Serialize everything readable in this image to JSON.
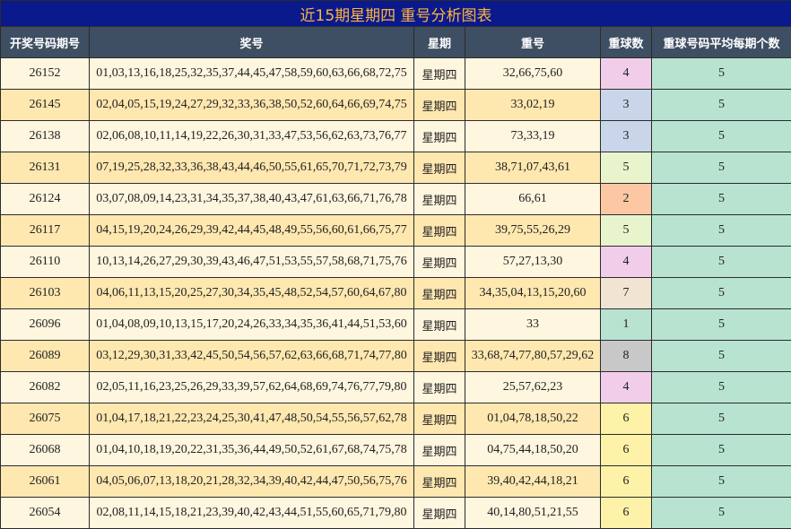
{
  "title": "近15期星期四 重号分析图表",
  "headers": [
    "开奖号码期号",
    "奖号",
    "星期",
    "重号",
    "重球数",
    "重球号码平均每期个数"
  ],
  "colors": {
    "title_bg": "#0a1a8c",
    "title_text": "#ffb43c",
    "header_bg": "#3e4e63",
    "row_light": "#fff6df",
    "row_dark": "#ffe8b0",
    "avg_bg": "#b8e3d1",
    "count_by_value": {
      "1": "#b8e3d1",
      "2": "#fcc8a4",
      "3": "#c9d6ea",
      "4": "#f2cde9",
      "5": "#e8f5cc",
      "6": "#fdf2a8",
      "7": "#f1e4d2",
      "8": "#c8c8c8"
    }
  },
  "rows": [
    {
      "period": "26152",
      "numbers": "01,03,13,16,18,25,32,35,37,44,45,47,58,59,60,63,66,68,72,75",
      "weekday": "星期四",
      "repeats": "32,66,75,60",
      "count": "4",
      "avg": "5"
    },
    {
      "period": "26145",
      "numbers": "02,04,05,15,19,24,27,29,32,33,36,38,50,52,60,64,66,69,74,75",
      "weekday": "星期四",
      "repeats": "33,02,19",
      "count": "3",
      "avg": "5"
    },
    {
      "period": "26138",
      "numbers": "02,06,08,10,11,14,19,22,26,30,31,33,47,53,56,62,63,73,76,77",
      "weekday": "星期四",
      "repeats": "73,33,19",
      "count": "3",
      "avg": "5"
    },
    {
      "period": "26131",
      "numbers": "07,19,25,28,32,33,36,38,43,44,46,50,55,61,65,70,71,72,73,79",
      "weekday": "星期四",
      "repeats": "38,71,07,43,61",
      "count": "5",
      "avg": "5"
    },
    {
      "period": "26124",
      "numbers": "03,07,08,09,14,23,31,34,35,37,38,40,43,47,61,63,66,71,76,78",
      "weekday": "星期四",
      "repeats": "66,61",
      "count": "2",
      "avg": "5"
    },
    {
      "period": "26117",
      "numbers": "04,15,19,20,24,26,29,39,42,44,45,48,49,55,56,60,61,66,75,77",
      "weekday": "星期四",
      "repeats": "39,75,55,26,29",
      "count": "5",
      "avg": "5"
    },
    {
      "period": "26110",
      "numbers": "10,13,14,26,27,29,30,39,43,46,47,51,53,55,57,58,68,71,75,76",
      "weekday": "星期四",
      "repeats": "57,27,13,30",
      "count": "4",
      "avg": "5"
    },
    {
      "period": "26103",
      "numbers": "04,06,11,13,15,20,25,27,30,34,35,45,48,52,54,57,60,64,67,80",
      "weekday": "星期四",
      "repeats": "34,35,04,13,15,20,60",
      "count": "7",
      "avg": "5"
    },
    {
      "period": "26096",
      "numbers": "01,04,08,09,10,13,15,17,20,24,26,33,34,35,36,41,44,51,53,60",
      "weekday": "星期四",
      "repeats": "33",
      "count": "1",
      "avg": "5"
    },
    {
      "period": "26089",
      "numbers": "03,12,29,30,31,33,42,45,50,54,56,57,62,63,66,68,71,74,77,80",
      "weekday": "星期四",
      "repeats": "33,68,74,77,80,57,29,62",
      "count": "8",
      "avg": "5"
    },
    {
      "period": "26082",
      "numbers": "02,05,11,16,23,25,26,29,33,39,57,62,64,68,69,74,76,77,79,80",
      "weekday": "星期四",
      "repeats": "25,57,62,23",
      "count": "4",
      "avg": "5"
    },
    {
      "period": "26075",
      "numbers": "01,04,17,18,21,22,23,24,25,30,41,47,48,50,54,55,56,57,62,78",
      "weekday": "星期四",
      "repeats": "01,04,78,18,50,22",
      "count": "6",
      "avg": "5"
    },
    {
      "period": "26068",
      "numbers": "01,04,10,18,19,20,22,31,35,36,44,49,50,52,61,67,68,74,75,78",
      "weekday": "星期四",
      "repeats": "04,75,44,18,50,20",
      "count": "6",
      "avg": "5"
    },
    {
      "period": "26061",
      "numbers": "04,05,06,07,13,18,20,21,28,32,34,39,40,42,44,47,50,56,75,76",
      "weekday": "星期四",
      "repeats": "39,40,42,44,18,21",
      "count": "6",
      "avg": "5"
    },
    {
      "period": "26054",
      "numbers": "02,08,11,14,15,18,21,23,39,40,42,43,44,51,55,60,65,71,79,80",
      "weekday": "星期四",
      "repeats": "40,14,80,51,21,55",
      "count": "6",
      "avg": "5"
    }
  ]
}
